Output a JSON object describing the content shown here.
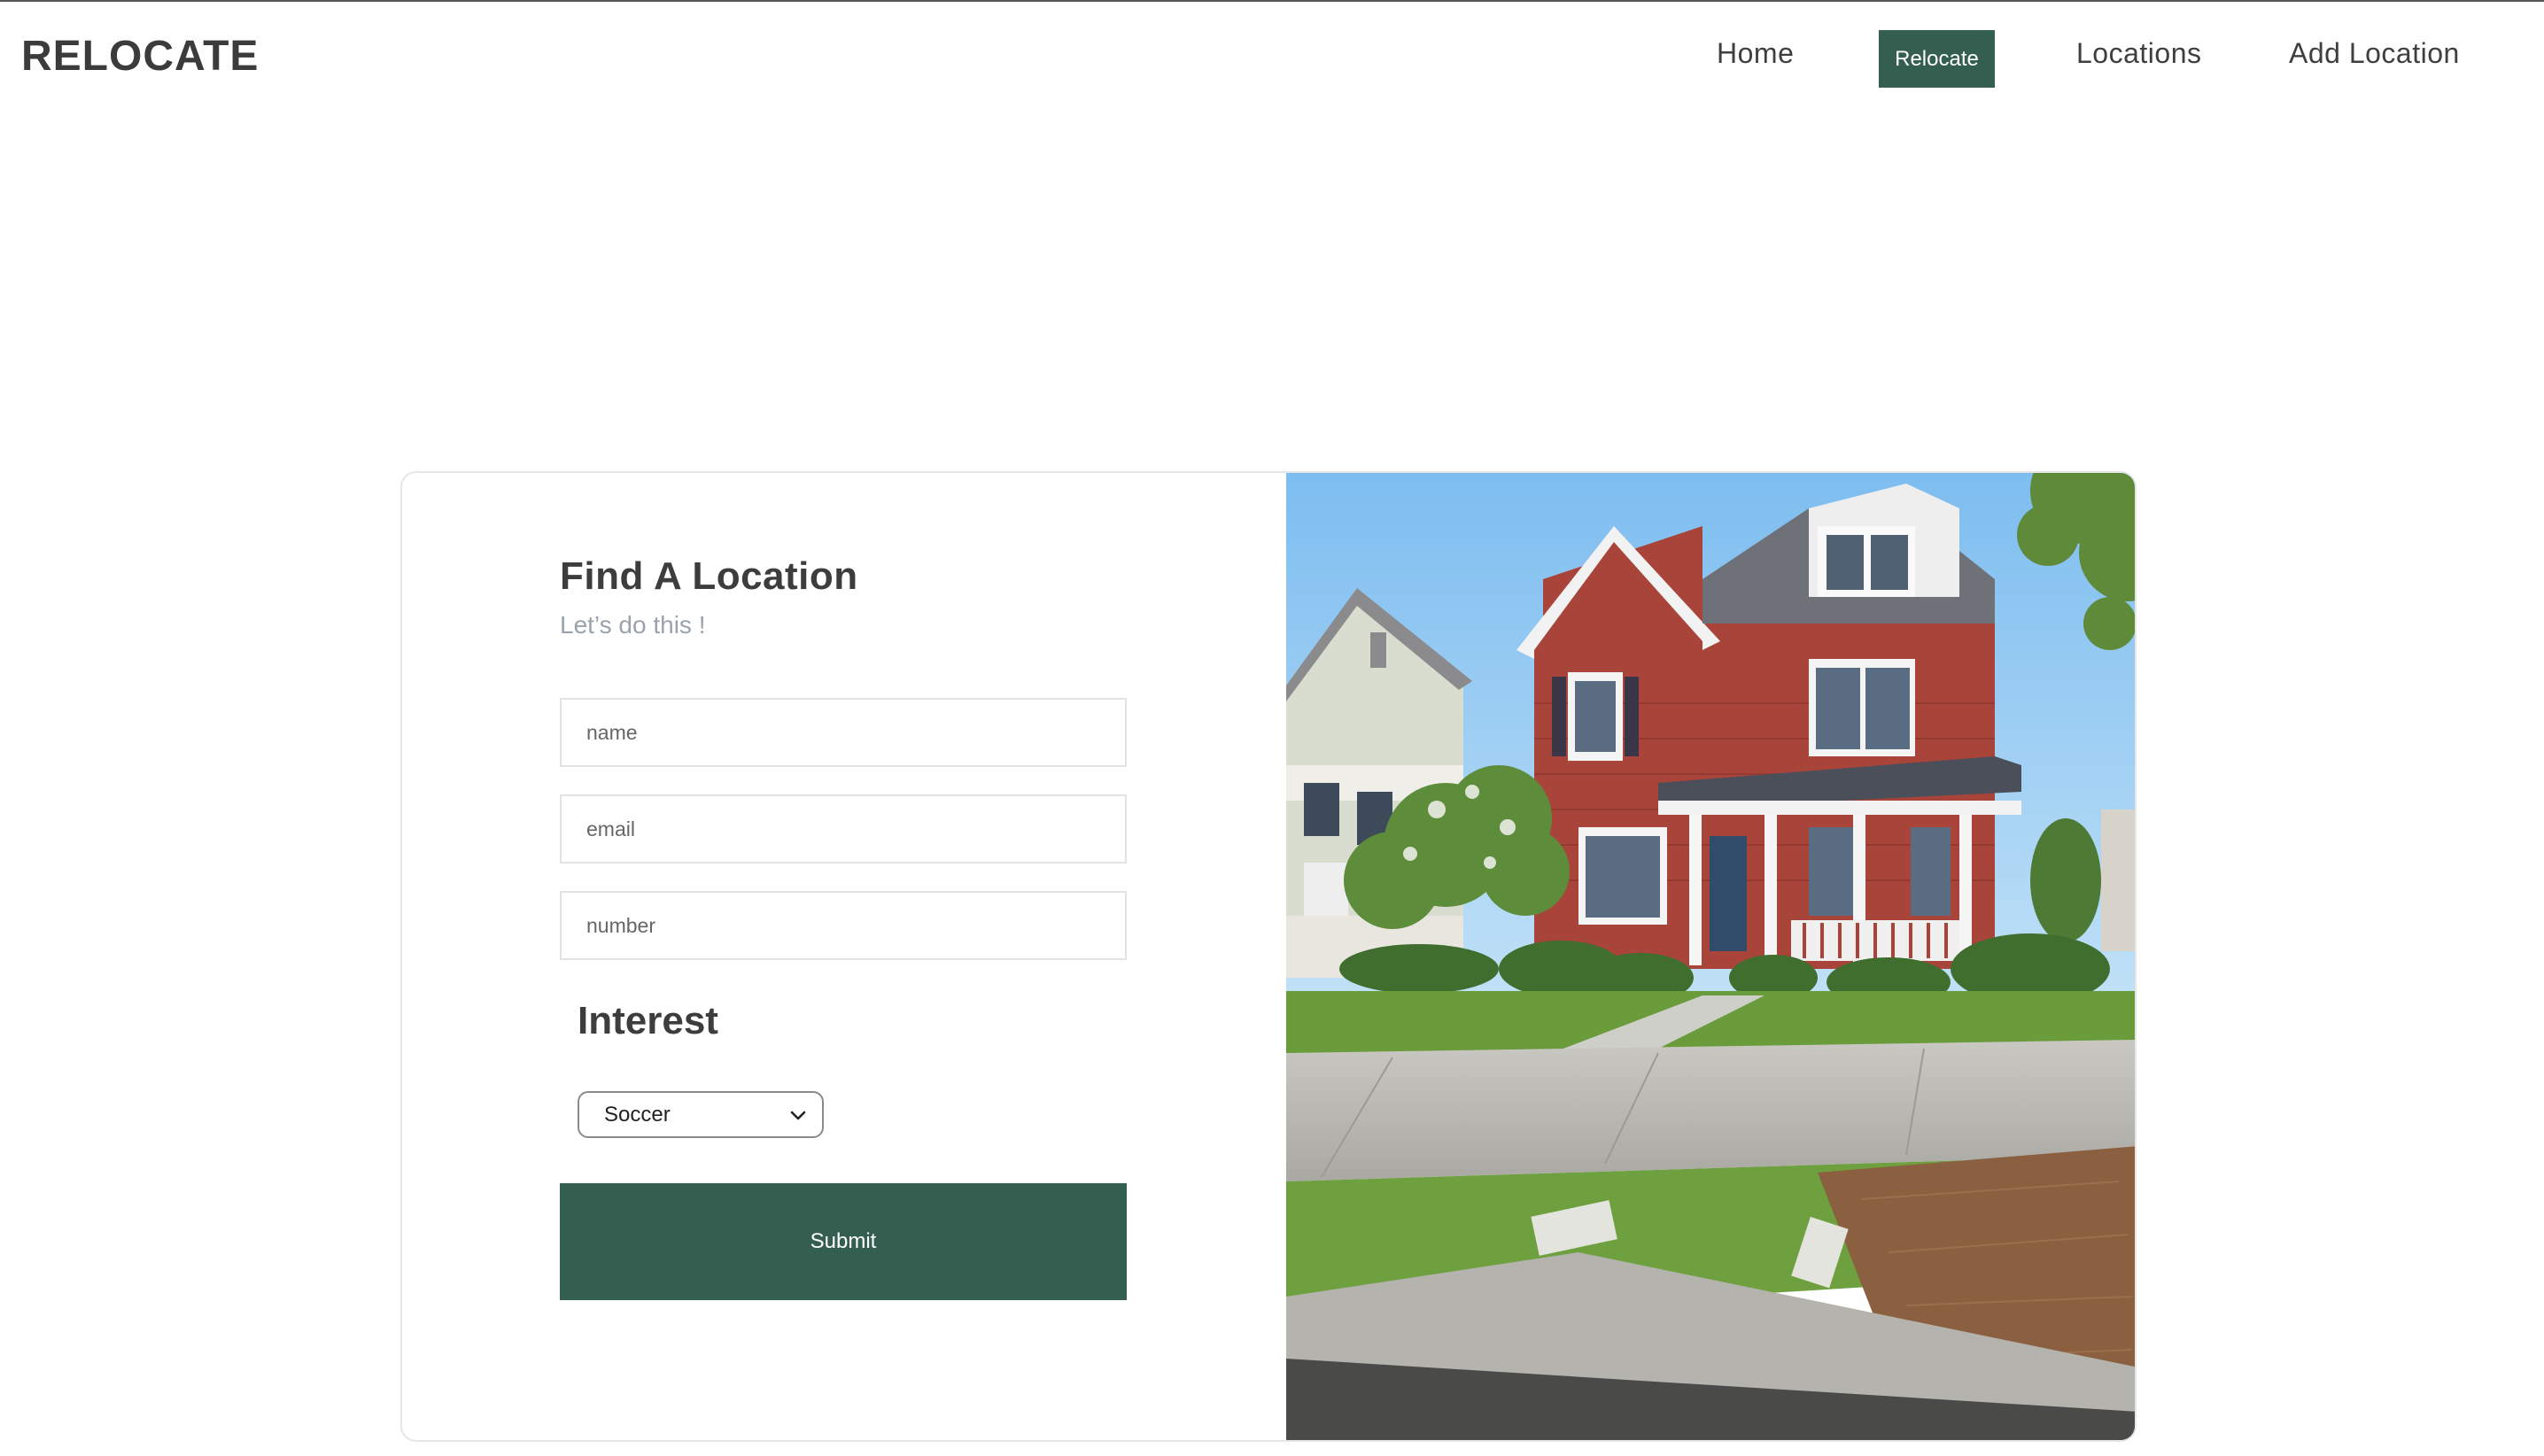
{
  "brand": "RELOCATE",
  "nav": {
    "home": "Home",
    "relocate": "Relocate",
    "locations": "Locations",
    "add_location": "Add Location"
  },
  "form": {
    "title": "Find A Location",
    "subtitle": "Let’s do this !",
    "name_placeholder": "name",
    "email_placeholder": "email",
    "number_placeholder": "number",
    "interest_label": "Interest",
    "interest_selected": "Soccer",
    "submit_label": "Submit"
  },
  "colors": {
    "accent": "#345f50",
    "house_red": "#a8443a",
    "sky": "#8cc6ee"
  }
}
